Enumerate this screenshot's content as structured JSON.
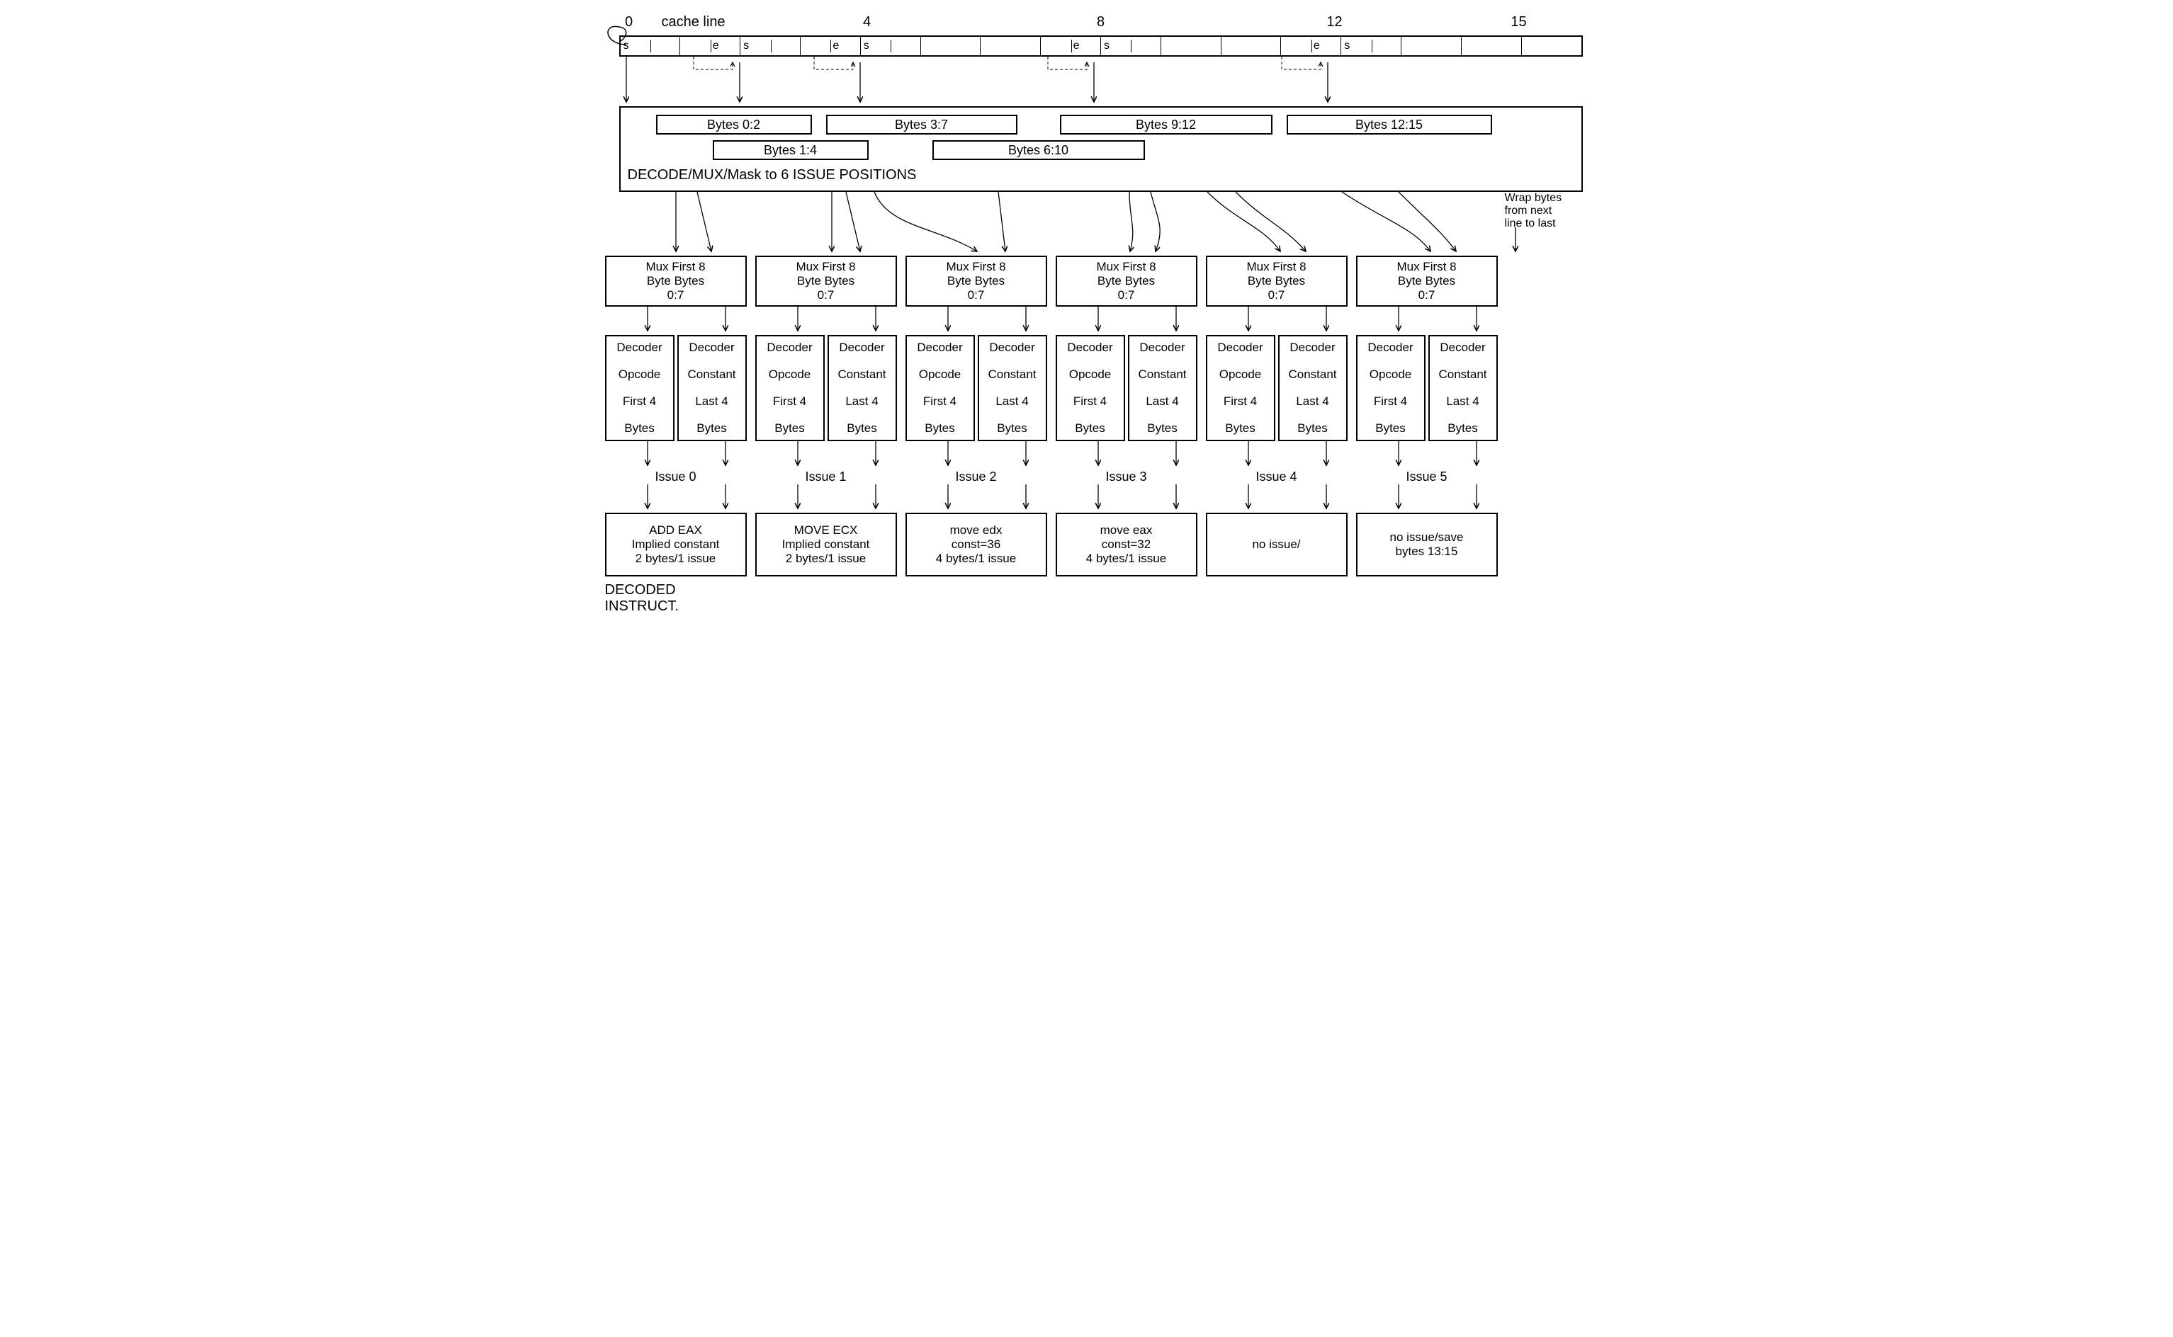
{
  "title": "cache line",
  "ticks": [
    "0",
    "4",
    "8",
    "12",
    "15"
  ],
  "bytes": [
    {
      "s": "s",
      "e": ""
    },
    {
      "s": "",
      "e": "e"
    },
    {
      "s": "s",
      "e": ""
    },
    {
      "s": "",
      "e": "e"
    },
    {
      "s": "s",
      "e": ""
    },
    {
      "s": "",
      "e": ""
    },
    {
      "s": "",
      "e": ""
    },
    {
      "s": "",
      "e": "e"
    },
    {
      "s": "s",
      "e": ""
    },
    {
      "s": "",
      "e": ""
    },
    {
      "s": "",
      "e": ""
    },
    {
      "s": "",
      "e": "e"
    },
    {
      "s": "s",
      "e": ""
    },
    {
      "s": "",
      "e": ""
    },
    {
      "s": "",
      "e": ""
    },
    {
      "s": "",
      "e": ""
    }
  ],
  "decode": {
    "row1": [
      "Bytes 0:2",
      "Bytes 3:7",
      "Bytes 9:12",
      "Bytes 12:15"
    ],
    "row2": [
      "Bytes 1:4",
      "Bytes 6:10"
    ],
    "label": "DECODE/MUX/Mask to 6 ISSUE POSITIONS"
  },
  "wrap_note": [
    "Wrap bytes",
    "from next",
    "line to last"
  ],
  "mux_label": [
    "Mux First 8",
    "Byte Bytes",
    "0:7"
  ],
  "decoder_opcode": [
    "Decoder",
    "Opcode",
    "First 4",
    "Bytes"
  ],
  "decoder_const": [
    "Decoder",
    "Constant",
    "Last 4",
    "Bytes"
  ],
  "issues": [
    "Issue 0",
    "Issue 1",
    "Issue 2",
    "Issue 3",
    "Issue 4",
    "Issue 5"
  ],
  "results": [
    [
      "ADD EAX",
      "Implied constant",
      "2 bytes/1 issue"
    ],
    [
      "MOVE ECX",
      "Implied constant",
      "2 bytes/1 issue"
    ],
    [
      "move edx",
      "const=36",
      "4 bytes/1 issue"
    ],
    [
      "move eax",
      "const=32",
      "4 bytes/1 issue"
    ],
    [
      "no issue/",
      "",
      ""
    ],
    [
      "no issue/save",
      "bytes 13:15",
      ""
    ]
  ],
  "footer": [
    "DECODED",
    "INSTRUCT."
  ]
}
